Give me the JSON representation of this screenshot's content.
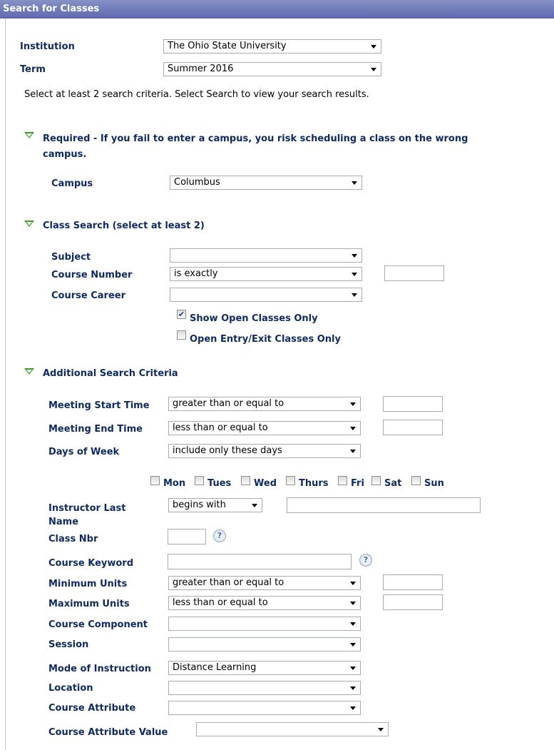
{
  "header": {
    "title": "Search for Classes"
  },
  "institution": {
    "label": "Institution",
    "value": "The Ohio State University"
  },
  "term": {
    "label": "Term",
    "value": "Summer 2016"
  },
  "instructions": "Select at least 2 search criteria. Select Search to view your search results.",
  "required_section": {
    "title_line1": "Required - If you fail to enter a campus, you risk scheduling a class on the wrong",
    "title_line2": "campus.",
    "campus_label": "Campus",
    "campus_value": "Columbus"
  },
  "class_search": {
    "title": "Class Search (select at least 2)",
    "subject_label": "Subject",
    "subject_value": "",
    "course_number_label": "Course Number",
    "course_number_op": "is exactly",
    "course_number_value": "",
    "course_career_label": "Course Career",
    "course_career_value": "",
    "show_open_label": "Show Open Classes Only",
    "show_open_checked": true,
    "open_entry_label": "Open Entry/Exit Classes Only",
    "open_entry_checked": false
  },
  "additional": {
    "title": "Additional Search Criteria",
    "meeting_start_label": "Meeting Start Time",
    "meeting_start_op": "greater than or equal to",
    "meeting_end_label": "Meeting End Time",
    "meeting_end_op": "less than or equal to",
    "days_label": "Days of Week",
    "days_op": "include only these days",
    "days": {
      "mon": "Mon",
      "tues": "Tues",
      "wed": "Wed",
      "thurs": "Thurs",
      "fri": "Fri",
      "sat": "Sat",
      "sun": "Sun"
    },
    "instructor_label_line1": "Instructor Last",
    "instructor_label_line2": "Name",
    "instructor_op": "begins with",
    "class_nbr_label": "Class Nbr",
    "course_keyword_label": "Course Keyword",
    "min_units_label": "Minimum Units",
    "min_units_op": "greater than or equal to",
    "max_units_label": "Maximum Units",
    "max_units_op": "less than or equal to",
    "course_component_label": "Course Component",
    "course_component_value": "",
    "session_label": "Session",
    "session_value": "",
    "mode_label": "Mode of Instruction",
    "mode_value": "Distance Learning",
    "location_label": "Location",
    "location_value": "",
    "course_attribute_label": "Course Attribute",
    "course_attribute_value": "",
    "course_attribute_value_label": "Course Attribute Value",
    "course_attribute_value_value": "",
    "help_glyph": "?"
  }
}
